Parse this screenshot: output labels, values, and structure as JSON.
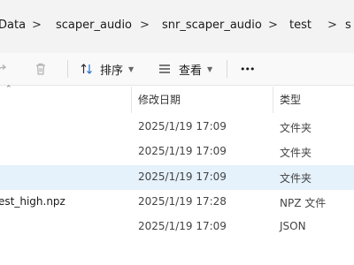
{
  "breadcrumb": {
    "items": [
      "Data",
      "scaper_audio",
      "snr_scaper_audio",
      "test",
      "s"
    ],
    "separator": ">"
  },
  "toolbar": {
    "sort_label": "排序",
    "view_label": "查看",
    "more_label": "•••"
  },
  "columns": {
    "modified": "修改日期",
    "type": "类型"
  },
  "rows": [
    {
      "name": "",
      "modified": "2025/1/19 17:09",
      "type": "文件夹",
      "selected": false
    },
    {
      "name": "",
      "modified": "2025/1/19 17:09",
      "type": "文件夹",
      "selected": false
    },
    {
      "name": "",
      "modified": "2025/1/19 17:09",
      "type": "文件夹",
      "selected": true
    },
    {
      "name": "est_high.npz",
      "modified": "2025/1/19 17:28",
      "type": "NPZ 文件",
      "selected": false
    },
    {
      "name": "",
      "modified": "2025/1/19 17:09",
      "type": "JSON",
      "selected": false
    }
  ],
  "icons": [
    "share-icon",
    "delete-icon",
    "sort-icon",
    "view-icon",
    "more-icon",
    "chevron-down-icon",
    "sort-arrow-icon"
  ]
}
